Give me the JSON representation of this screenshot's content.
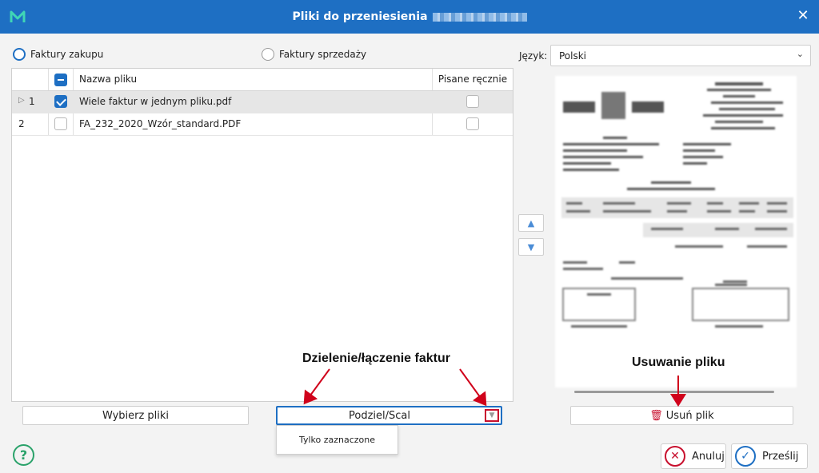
{
  "window": {
    "title": "Pliki do przeniesienia",
    "close_icon": "close-icon",
    "logo_icon": "app-logo-icon",
    "accent_color": "#1e6fc3"
  },
  "invoice_type": {
    "purchase_label": "Faktury zakupu",
    "sales_label": "Faktury sprzedaży",
    "selected": "purchase"
  },
  "table": {
    "columns": [
      "Nazwa pliku",
      "Pisane ręcznie"
    ],
    "rows": [
      {
        "index": "1",
        "name": "Wiele faktur w jednym pliku.pdf",
        "checked": true,
        "handwritten": false,
        "expandable": true,
        "selected": true
      },
      {
        "index": "2",
        "name": "FA_232_2020_Wzór_standard.PDF",
        "checked": false,
        "handwritten": false,
        "expandable": false,
        "selected": false
      }
    ]
  },
  "buttons": {
    "choose_files": "Wybierz pliki",
    "split_merge": "Podziel/Scal",
    "split_option": "Tylko zaznaczone",
    "remove_file": "Usuń plik",
    "cancel": "Anuluj",
    "send": "Prześlij"
  },
  "language": {
    "label": "Język:",
    "value": "Polski"
  },
  "annotations": {
    "split_merge_note": "Dzielenie/łączenie faktur",
    "remove_note": "Usuwanie pliku",
    "arrow_color": "#d0021b"
  },
  "icons": {
    "help": "help-icon",
    "move_up": "arrow-up-icon",
    "move_down": "arrow-down-icon",
    "trash": "trash-icon",
    "cancel": "cancel-icon",
    "send": "send-icon"
  }
}
